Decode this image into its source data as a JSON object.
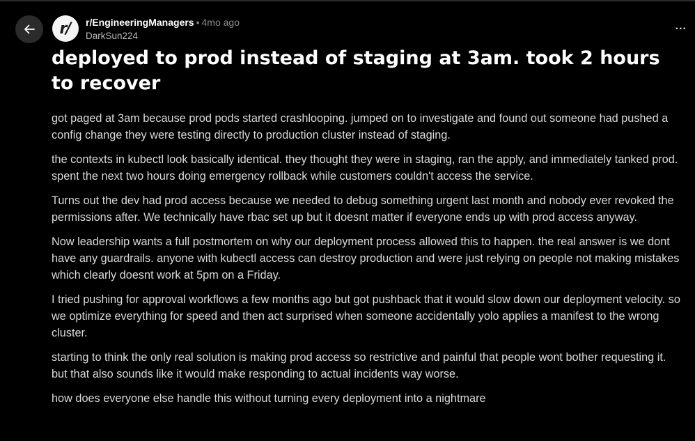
{
  "nav": {
    "back_icon": "arrow-left-icon",
    "more_icon": "more-horizontal-icon",
    "more_label": "..."
  },
  "post": {
    "subreddit": "r/EngineeringManagers",
    "separator": "•",
    "time_ago": "4mo ago",
    "author": "DarkSun224",
    "avatar_text": "r/",
    "title": "deployed to prod instead of staging at 3am. took 2 hours to recover",
    "paragraphs": [
      "got paged at 3am because prod pods started crashlooping. jumped on to investigate and found out someone had pushed a config change they were testing directly to production cluster instead of staging.",
      "the contexts in kubectl look basically identical. they thought they were in staging, ran the apply, and immediately tanked prod. spent the next two hours doing emergency rollback while customers couldn't access the service.",
      "Turns out the dev had prod access because we needed to debug something urgent last month and nobody ever revoked the permissions after. We technically have rbac set up but it doesnt matter if everyone ends up with prod access anyway.",
      "Now leadership wants a full postmortem on why our deployment process allowed this to happen. the real answer is we dont have any guardrails. anyone with kubectl access can destroy production and were just relying on people not making mistakes which clearly doesnt work at 5pm on a Friday.",
      "I tried pushing for approval workflows a few months ago but got pushback that it would slow down our deployment velocity. so we optimize everything for speed and then act surprised when someone accidentally yolo applies a manifest to the wrong cluster.",
      "starting to think the only real solution is making prod access so restrictive and painful that people wont bother requesting it. but that also sounds like it would make responding to actual incidents way worse.",
      "how does everyone else handle this without turning every deployment into a nightmare"
    ]
  },
  "colors": {
    "background": "#000000",
    "text": "#d7dadc",
    "title": "#ffffff",
    "muted": "#8a8c8e",
    "button_bg": "#2b2b2b"
  }
}
